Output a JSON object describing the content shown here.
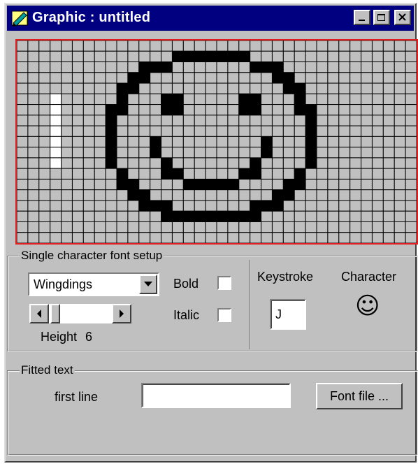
{
  "window": {
    "title": "Graphic : untitled"
  },
  "grid": {
    "cols": 36,
    "rows": 19,
    "off_color": "#c0c0c0",
    "on_color": "#000000",
    "highlight_color": "#ffffff",
    "on_cells": [
      [
        1,
        14
      ],
      [
        1,
        15
      ],
      [
        1,
        16
      ],
      [
        1,
        17
      ],
      [
        1,
        18
      ],
      [
        1,
        19
      ],
      [
        1,
        20
      ],
      [
        2,
        11
      ],
      [
        2,
        12
      ],
      [
        2,
        13
      ],
      [
        2,
        21
      ],
      [
        2,
        22
      ],
      [
        2,
        23
      ],
      [
        3,
        10
      ],
      [
        3,
        11
      ],
      [
        3,
        23
      ],
      [
        3,
        24
      ],
      [
        4,
        9
      ],
      [
        4,
        10
      ],
      [
        4,
        24
      ],
      [
        4,
        25
      ],
      [
        5,
        9
      ],
      [
        5,
        13
      ],
      [
        5,
        14
      ],
      [
        5,
        20
      ],
      [
        5,
        21
      ],
      [
        5,
        25
      ],
      [
        6,
        8
      ],
      [
        6,
        9
      ],
      [
        6,
        13
      ],
      [
        6,
        14
      ],
      [
        6,
        20
      ],
      [
        6,
        21
      ],
      [
        6,
        25
      ],
      [
        6,
        26
      ],
      [
        7,
        8
      ],
      [
        7,
        26
      ],
      [
        8,
        8
      ],
      [
        8,
        26
      ],
      [
        9,
        8
      ],
      [
        9,
        12
      ],
      [
        9,
        22
      ],
      [
        9,
        26
      ],
      [
        10,
        8
      ],
      [
        10,
        12
      ],
      [
        10,
        22
      ],
      [
        10,
        26
      ],
      [
        11,
        8
      ],
      [
        11,
        13
      ],
      [
        11,
        21
      ],
      [
        11,
        26
      ],
      [
        12,
        9
      ],
      [
        12,
        13
      ],
      [
        12,
        14
      ],
      [
        12,
        20
      ],
      [
        12,
        21
      ],
      [
        12,
        25
      ],
      [
        13,
        9
      ],
      [
        13,
        10
      ],
      [
        13,
        15
      ],
      [
        13,
        16
      ],
      [
        13,
        17
      ],
      [
        13,
        18
      ],
      [
        13,
        19
      ],
      [
        13,
        24
      ],
      [
        13,
        25
      ],
      [
        14,
        10
      ],
      [
        14,
        11
      ],
      [
        14,
        23
      ],
      [
        14,
        24
      ],
      [
        15,
        11
      ],
      [
        15,
        12
      ],
      [
        15,
        13
      ],
      [
        15,
        21
      ],
      [
        15,
        22
      ],
      [
        15,
        23
      ],
      [
        16,
        13
      ],
      [
        16,
        14
      ],
      [
        16,
        15
      ],
      [
        16,
        16
      ],
      [
        16,
        17
      ],
      [
        16,
        18
      ],
      [
        16,
        19
      ],
      [
        16,
        20
      ],
      [
        16,
        21
      ]
    ],
    "highlight_cells": [
      [
        5,
        3
      ],
      [
        6,
        3
      ],
      [
        7,
        3
      ],
      [
        8,
        3
      ],
      [
        9,
        3
      ],
      [
        10,
        3
      ],
      [
        11,
        3
      ]
    ]
  },
  "font_setup": {
    "legend": "Single character font setup",
    "font_name": "Wingdings",
    "bold_label": "Bold",
    "italic_label": "Italic",
    "bold_checked": false,
    "italic_checked": false,
    "height_label": "Height",
    "height_value": "6",
    "keystroke_label": "Keystroke",
    "keystroke_value": "J",
    "character_label": "Character",
    "character_glyph": "☺"
  },
  "fitted_text": {
    "legend": "Fitted text",
    "first_line_label": "first line",
    "first_line_value": "",
    "font_file_button": "Font file ..."
  }
}
